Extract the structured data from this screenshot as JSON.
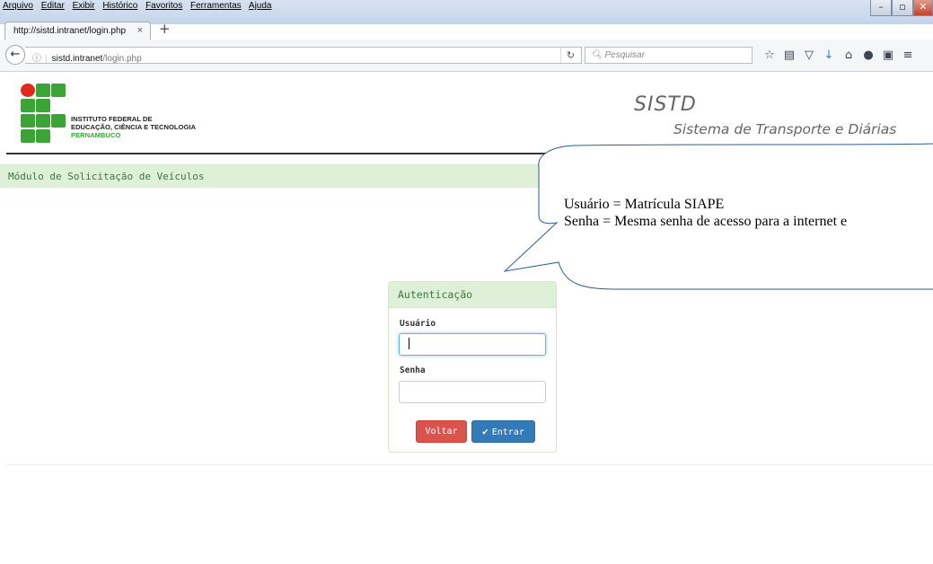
{
  "browser": {
    "menu": [
      "Arquivo",
      "Editar",
      "Exibir",
      "Histórico",
      "Favoritos",
      "Ferramentas",
      "Ajuda"
    ],
    "tab_title": "http://sistd.intranet/login.php",
    "tab_close": "×",
    "new_tab": "+",
    "url_host": "sistd.intranet",
    "url_path": "/login.php",
    "search_placeholder": "Pesquisar",
    "window_controls": {
      "minimize": "–",
      "maximize": "▫",
      "close": "✕"
    },
    "toolbar_icons": [
      "star-icon",
      "reading-list-icon",
      "pocket-icon",
      "download-icon",
      "home-icon",
      "chat-icon",
      "screenshot-icon",
      "menu-icon"
    ]
  },
  "header": {
    "institution_line1": "INSTITUTO FEDERAL DE",
    "institution_line2": "EDUCAÇÃO, CIÊNCIA E TECNOLOGIA",
    "institution_campus": "PERNAMBUCO",
    "system_name": "SISTD",
    "system_subtitle": "Sistema de Transporte e Diárias"
  },
  "module": {
    "title": "Módulo de Solicitação de Veículos"
  },
  "login": {
    "heading": "Autenticação",
    "user_label": "Usuário",
    "user_value": "",
    "password_label": "Senha",
    "password_value": "",
    "back_button": "Voltar",
    "submit_button": "Entrar"
  },
  "callout": {
    "line1": "Usuário = Matrícula SIAPE",
    "line2": "Senha = Mesma senha de acesso para a internet e"
  },
  "colors": {
    "success_bg": "#dff0d8",
    "success_text": "#3c763d",
    "danger": "#d9534f",
    "primary": "#337ab7",
    "logo_green": "#3aa535",
    "logo_red": "#e3261e"
  }
}
